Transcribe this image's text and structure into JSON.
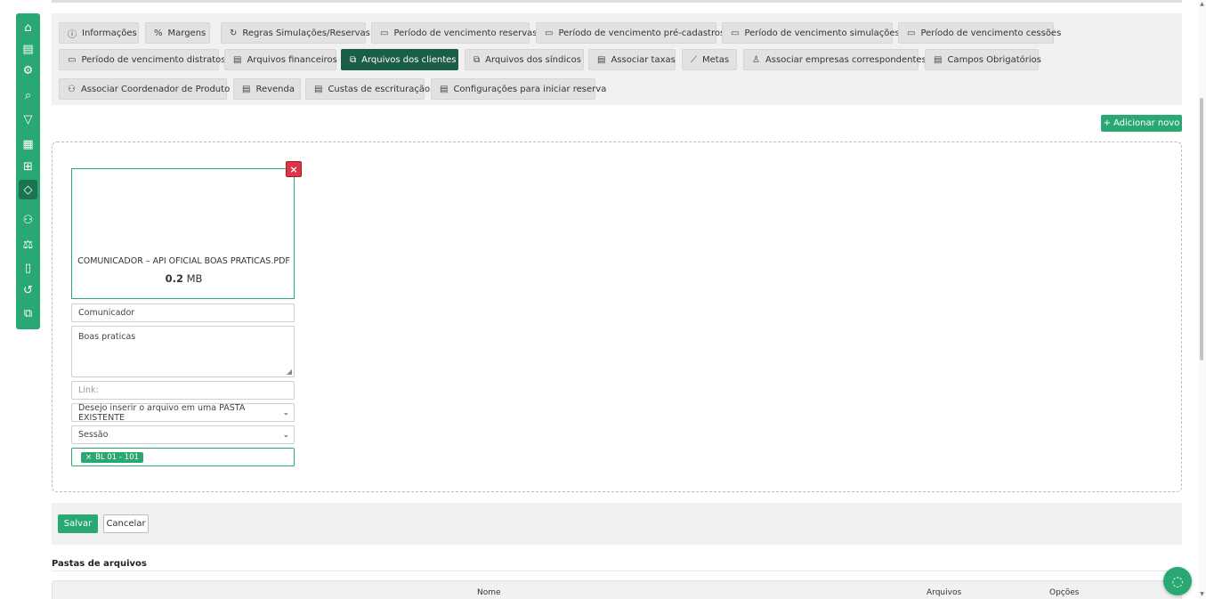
{
  "sidebar": {
    "items": [
      {
        "key": "home",
        "icon": "home-icon",
        "glyph": "⌂"
      },
      {
        "key": "document",
        "icon": "document-icon",
        "glyph": "▤"
      },
      {
        "key": "settings",
        "icon": "gear-icon",
        "glyph": "⚙"
      },
      {
        "key": "search",
        "icon": "search-icon",
        "glyph": "⌕"
      },
      {
        "key": "filter",
        "icon": "filter-icon",
        "glyph": "▽"
      },
      {
        "key": "calculator",
        "icon": "calculator-icon",
        "glyph": "▦"
      },
      {
        "key": "table",
        "icon": "table-icon",
        "glyph": "⊞"
      },
      {
        "key": "tag",
        "icon": "tag-icon",
        "glyph": "◇",
        "active": true
      },
      {
        "key": "users",
        "icon": "users-icon",
        "glyph": "⚇"
      },
      {
        "key": "scale",
        "icon": "scale-icon",
        "glyph": "⚖"
      },
      {
        "key": "mobile",
        "icon": "mobile-icon",
        "glyph": "▯"
      },
      {
        "key": "history",
        "icon": "history-icon",
        "glyph": "↺"
      },
      {
        "key": "copy",
        "icon": "copy-icon",
        "glyph": "⧉"
      }
    ]
  },
  "tabs": [
    {
      "label": "Informações",
      "icon": "info-icon",
      "glyph": "ⓘ"
    },
    {
      "label": "Margens",
      "icon": "percent-icon",
      "glyph": "%"
    },
    {
      "label": "Regras Simulações/Reservas",
      "icon": "refresh-icon",
      "glyph": "↻"
    },
    {
      "label": "Período de vencimento reservas",
      "icon": "calendar-icon",
      "glyph": "▭"
    },
    {
      "label": "Período de vencimento pré-cadastros",
      "icon": "calendar-icon",
      "glyph": "▭"
    },
    {
      "label": "Período de vencimento simulações",
      "icon": "calendar-icon",
      "glyph": "▭"
    },
    {
      "label": "Período de vencimento cessões",
      "icon": "calendar-icon",
      "glyph": "▭"
    },
    {
      "label": "Período de vencimento distratos",
      "icon": "calendar-icon",
      "glyph": "▭"
    },
    {
      "label": "Arquivos financeiros",
      "icon": "file-icon",
      "glyph": "▤"
    },
    {
      "label": "Arquivos dos clientes",
      "icon": "files-icon",
      "glyph": "⧉",
      "active": true
    },
    {
      "label": "Arquivos dos síndicos",
      "icon": "files-icon",
      "glyph": "⧉"
    },
    {
      "label": "Associar taxas",
      "icon": "file-icon",
      "glyph": "▤"
    },
    {
      "label": "Metas",
      "icon": "chart-line-icon",
      "glyph": "⟋"
    },
    {
      "label": "Associar empresas correspondentes",
      "icon": "user-icon",
      "glyph": "♙"
    },
    {
      "label": "Campos Obrigatórios",
      "icon": "file-icon",
      "glyph": "▤"
    },
    {
      "label": "Associar Coordenador de Produto",
      "icon": "people-icon",
      "glyph": "⚇"
    },
    {
      "label": "Revenda",
      "icon": "file-icon",
      "glyph": "▤"
    },
    {
      "label": "Custas de escrituração",
      "icon": "file-icon",
      "glyph": "▤"
    },
    {
      "label": "Configurações para iniciar reserva",
      "icon": "file-icon",
      "glyph": "▤"
    }
  ],
  "add_button": {
    "label": "Adicionar novo",
    "glyph": "+"
  },
  "file": {
    "name": "COMUNICADOR – API OFICIAL BOAS PRATICAS.PDF",
    "size_value": "0.2",
    "size_unit": "MB",
    "close_glyph": "×"
  },
  "form": {
    "title_value": "Comunicador",
    "description_value": "Boas praticas",
    "link_placeholder": "Link:",
    "folder_select": "Desejo inserir o arquivo em uma PASTA EXISTENTE",
    "session_select": "Sessão",
    "tags": [
      {
        "label": "BL 01 - 101",
        "remove": "×"
      }
    ]
  },
  "actions": {
    "save_label": "Salvar",
    "cancel_label": "Cancelar"
  },
  "folders": {
    "title": "Pastas de arquivos",
    "columns": {
      "name": "Nome",
      "files": "Arquivos",
      "options": "Opções"
    }
  },
  "colors": {
    "accent": "#2aa874",
    "active_tab": "#1b5e48",
    "danger": "#dc3545"
  }
}
